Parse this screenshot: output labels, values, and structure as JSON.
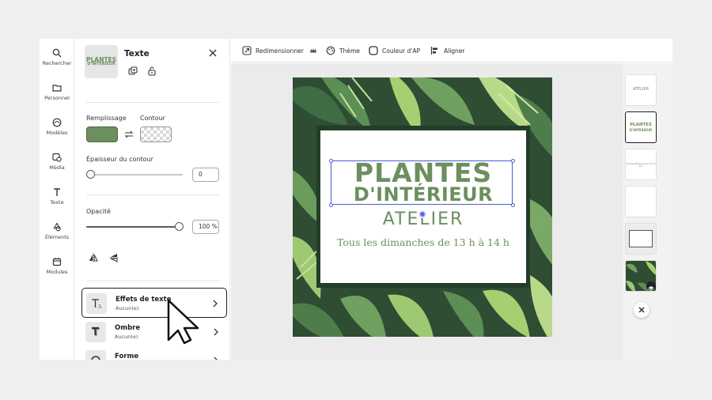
{
  "rail": {
    "items": [
      {
        "label": "Rechercher",
        "icon": "search-icon"
      },
      {
        "label": "Personnel",
        "icon": "folder-icon"
      },
      {
        "label": "Modèles",
        "icon": "templates-icon"
      },
      {
        "label": "Média",
        "icon": "media-icon"
      },
      {
        "label": "Texte",
        "icon": "text-icon"
      },
      {
        "label": "Éléments",
        "icon": "elements-icon"
      },
      {
        "label": "Modules",
        "icon": "modules-icon"
      }
    ]
  },
  "panel": {
    "title": "Texte",
    "thumb": {
      "line1": "PLANTES",
      "line2": "D'INTÉRIEUR"
    },
    "fill_label": "Remplissage",
    "stroke_label": "Contour",
    "fill_color": "#6b8f5e",
    "stroke_width_label": "Épaisseur du contour",
    "stroke_width_value": "0",
    "opacity_label": "Opacité",
    "opacity_value": "100 %",
    "effects": [
      {
        "name": "Effets de texte",
        "sub": "Aucun(e)"
      },
      {
        "name": "Ombre",
        "sub": "Aucun(e)"
      },
      {
        "name": "Forme",
        "sub": ""
      }
    ]
  },
  "toolbar": {
    "resize": "Redimensionner",
    "theme": "Thème",
    "bg_color": "Couleur d'AP",
    "align": "Aligner"
  },
  "artboard": {
    "line1": "PLANTES",
    "line2": "D'INTÉRIEUR",
    "line3": "ATELIER",
    "line4": "Tous les dimanches de 13 h à 14 h",
    "text_color": "#6b8f5e",
    "bg_color": "#2e4d33"
  },
  "pages": {
    "p1_text": "ATELIER",
    "p2_line1": "PLANTES",
    "p2_line2": "D'INTÉRIEUR",
    "p3_text": "Tous les dimanches de 13 h à 14 h"
  }
}
